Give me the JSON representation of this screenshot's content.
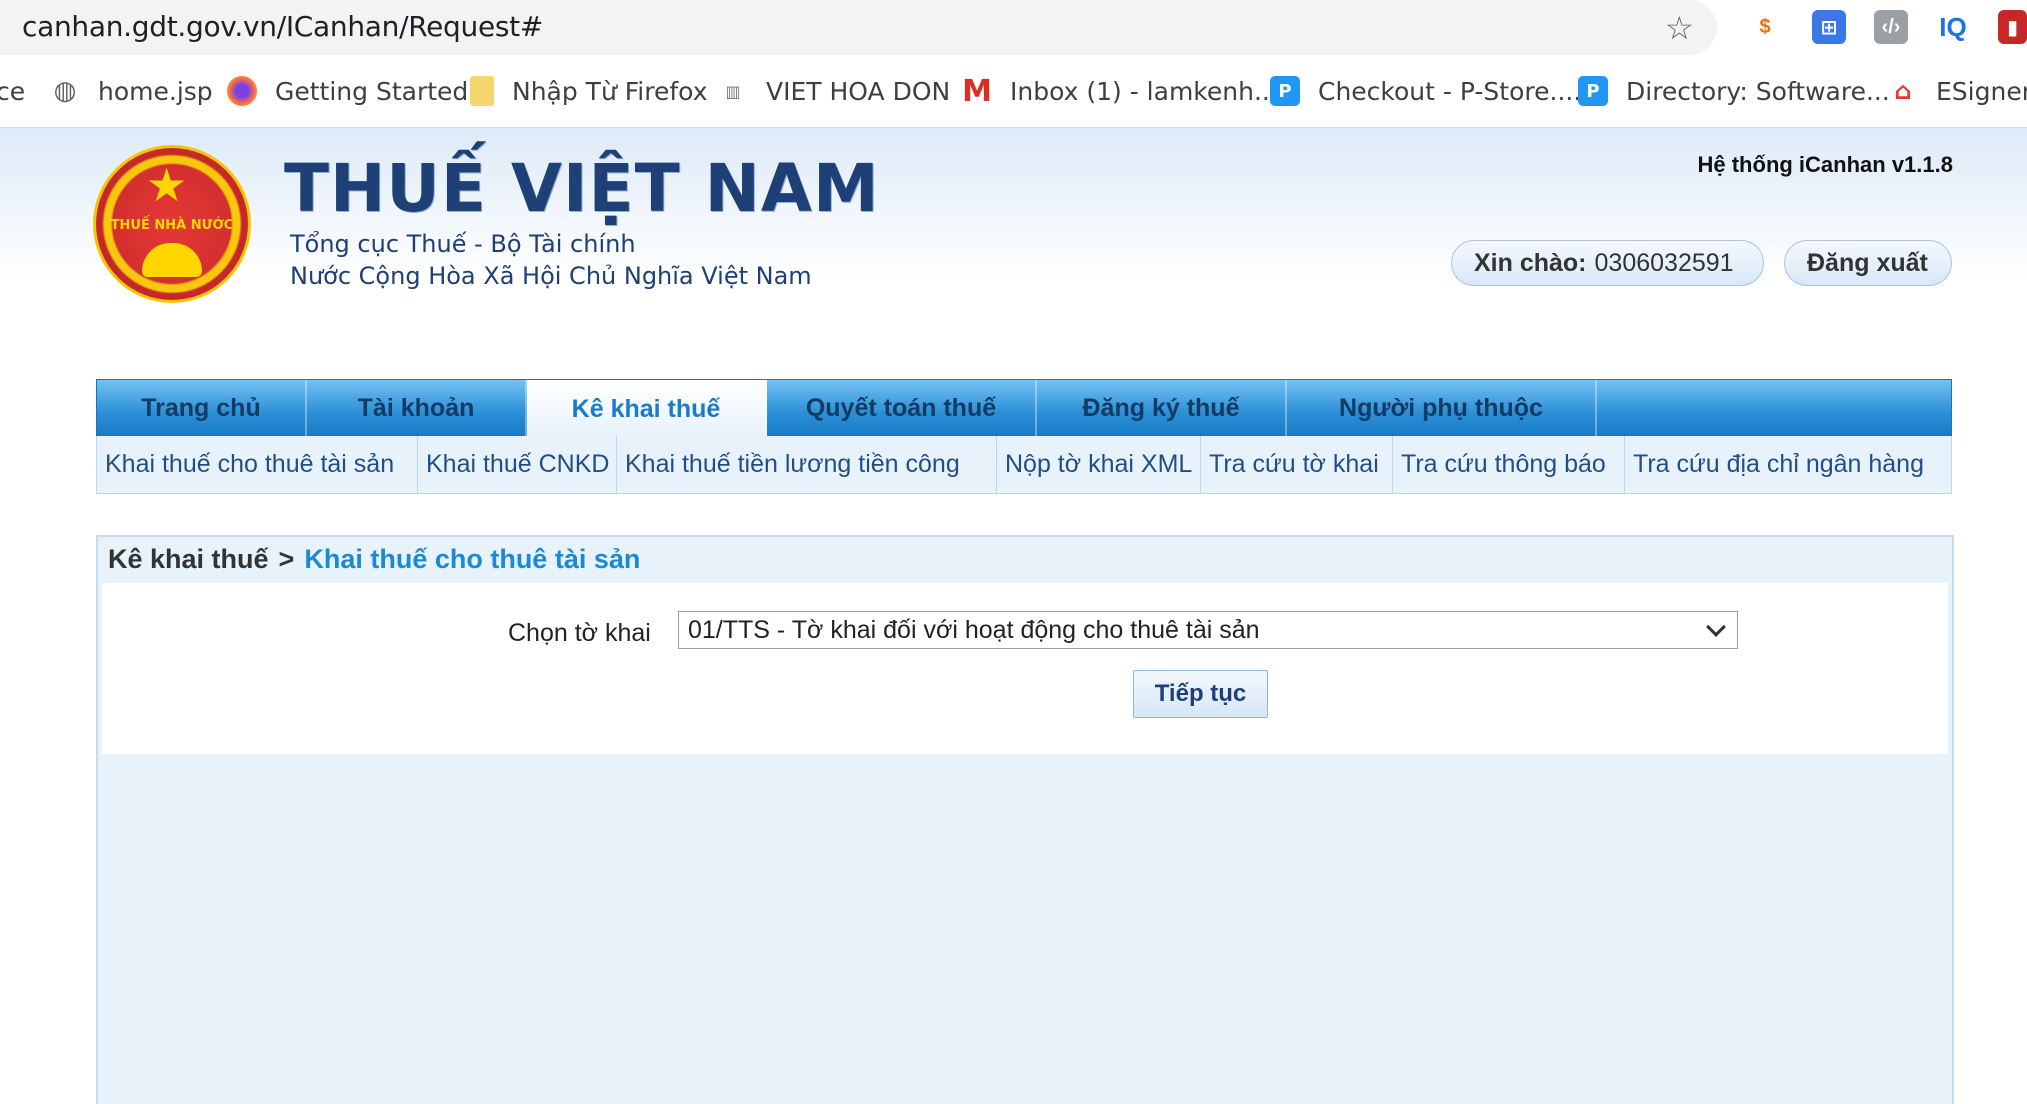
{
  "browser": {
    "url": "canhan.gdt.gov.vn/ICanhan/Request#",
    "bookmarks": [
      {
        "label": "ce",
        "icon": "page-icon"
      },
      {
        "label": "home.jsp",
        "icon": "globe-icon"
      },
      {
        "label": "Getting Started",
        "icon": "firefox-icon"
      },
      {
        "label": "Nhập Từ Firefox",
        "icon": "folder-icon"
      },
      {
        "label": "VIET HOA DON",
        "icon": "invoice-icon"
      },
      {
        "label": "Inbox (1) - lamkenh...",
        "icon": "gmail-icon"
      },
      {
        "label": "Checkout - P-Store....",
        "icon": "pstore-icon"
      },
      {
        "label": "Directory: Software...",
        "icon": "pstore-icon"
      },
      {
        "label": "ESigner.C",
        "icon": "esigner-icon"
      }
    ],
    "extensions": {
      "iq": "IQ"
    }
  },
  "header": {
    "emblem_text": "THUẾ NHÀ NƯỚC",
    "title": "THUẾ VIỆT NAM",
    "subtitle1": "Tổng cục Thuế - Bộ Tài chính",
    "subtitle2": "Nước Cộng Hòa Xã Hội Chủ Nghĩa Việt Nam",
    "system_version": "Hệ thống iCanhan v1.1.8",
    "greeting_label": "Xin chào:",
    "greeting_user": "0306032591",
    "logout": "Đăng xuất"
  },
  "nav": {
    "items": [
      "Trang chủ",
      "Tài khoản",
      "Kê khai thuế",
      "Quyết toán thuế",
      "Đăng ký thuế",
      "Người phụ thuộc"
    ],
    "active": "Kê khai thuế",
    "sub_items": [
      "Khai thuế cho thuê tài sản",
      "Khai thuế CNKD",
      "Khai thuế tiền lương tiền công",
      "Nộp tờ khai XML",
      "Tra cứu tờ khai",
      "Tra cứu thông báo",
      "Tra cứu địa chỉ ngân hàng"
    ]
  },
  "panel": {
    "breadcrumb_root": "Kê khai thuế",
    "breadcrumb_sep": ">",
    "breadcrumb_current": "Khai thuế cho thuê tài sản",
    "select_label": "Chọn tờ khai",
    "select_value": "01/TTS - Tờ khai đối với hoạt động cho thuê tài sản",
    "submit": "Tiếp tục"
  },
  "colors": {
    "nav_blue": "#2b8fd6",
    "title_navy": "#1f3f77",
    "link_blue": "#1a8ad6"
  }
}
